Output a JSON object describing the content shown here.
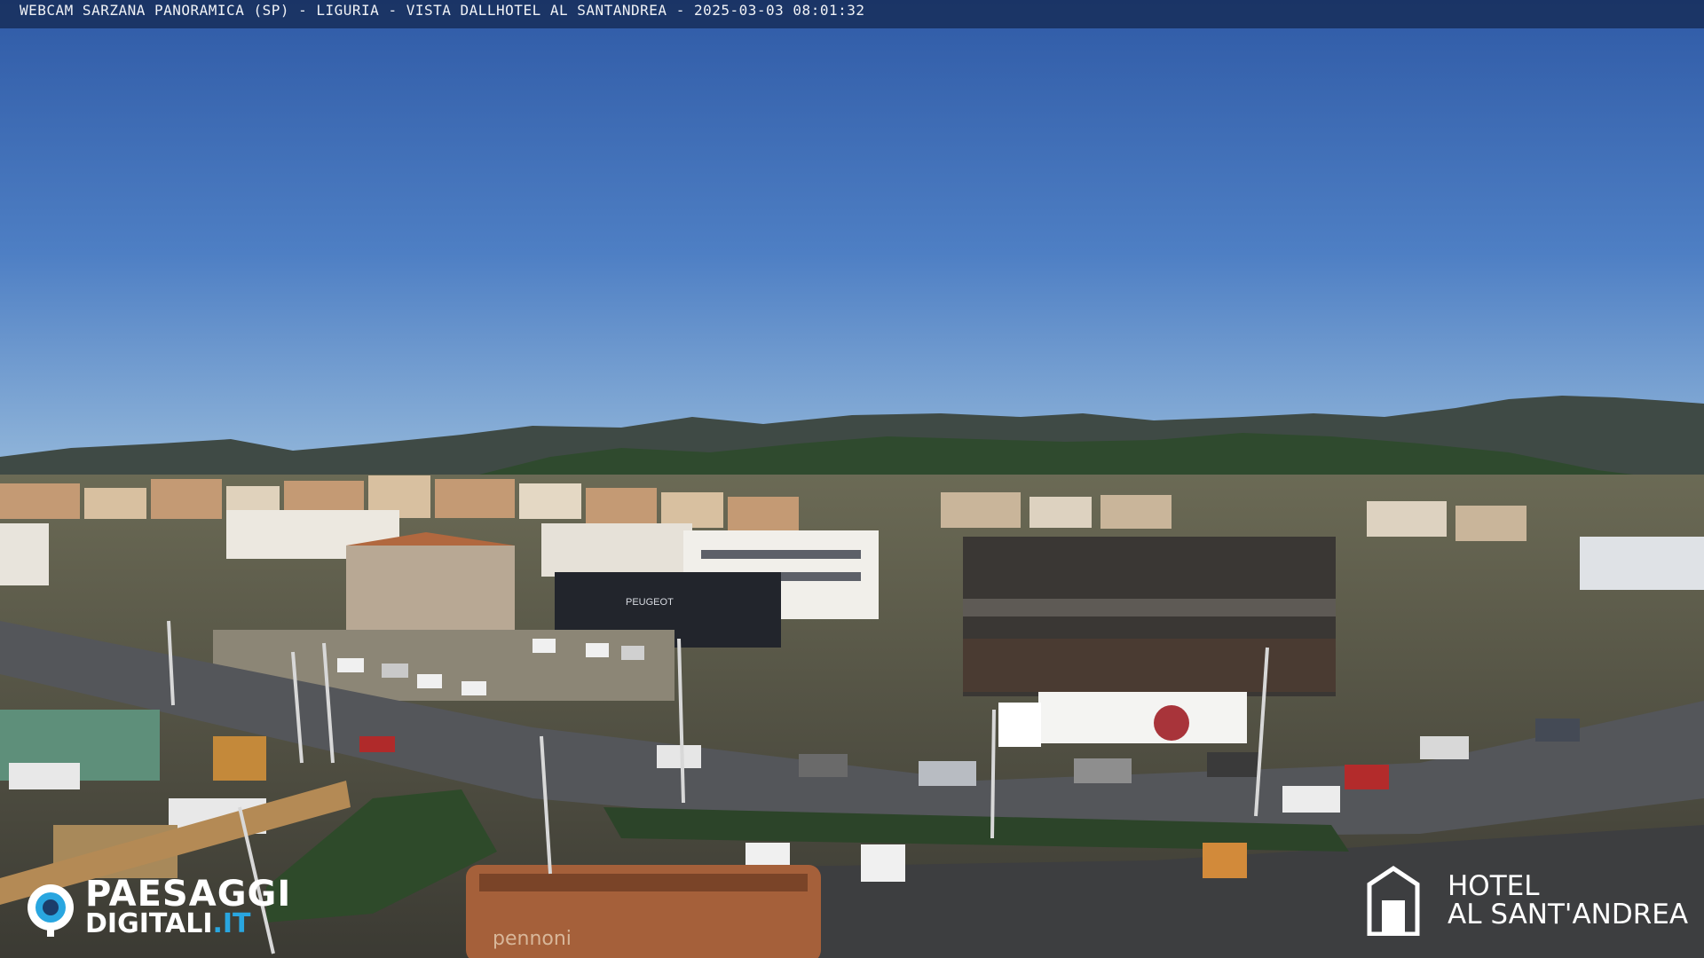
{
  "overlay": {
    "title": "WEBCAM SARZANA PANORAMICA (SP) - LIGURIA - VISTA DALLHOTEL AL SANTANDREA - 2025-03-03  08:01:32"
  },
  "logos": {
    "left": {
      "line1": "PAESAGGI",
      "line2_main": "DIGITALI",
      "line2_accent": ".IT"
    },
    "right": {
      "line1": "HOTEL",
      "line2": "AL SANT'ANDREA"
    }
  },
  "scene": {
    "signs": {
      "dealer": "PEUGEOT",
      "bus": "pennoni"
    }
  }
}
